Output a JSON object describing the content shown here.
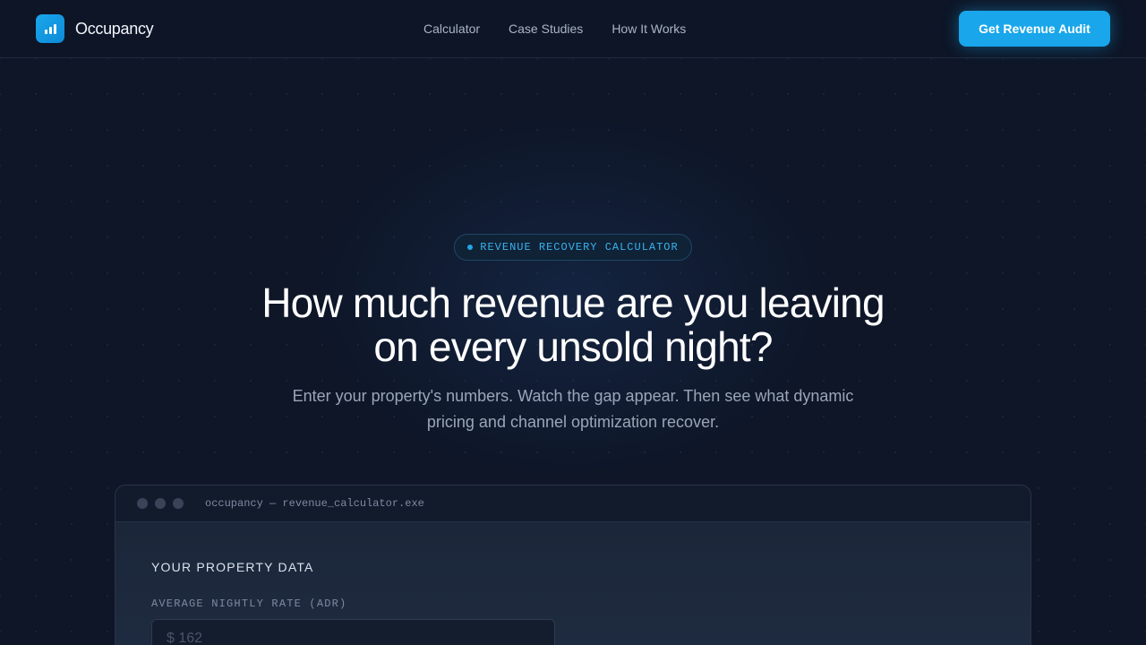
{
  "nav": {
    "logo": "Occupancy",
    "links": [
      "Calculator",
      "Case Studies",
      "How It Works"
    ],
    "cta": "Get Revenue Audit"
  },
  "hero": {
    "badge": "REVENUE RECOVERY CALCULATOR",
    "headline_line1": "How much revenue are you leaving",
    "headline_line2": "on every unsold night?",
    "sub_line1": "Enter your property's numbers. Watch the gap appear. Then see what dynamic",
    "sub_line2": "pricing and channel optimization recover."
  },
  "calculator": {
    "window_title": "occupancy — revenue_calculator.exe",
    "section_title": "YOUR PROPERTY DATA",
    "adr_label": "AVERAGE NIGHTLY RATE (ADR)",
    "currency": "$",
    "adr_value": "162"
  },
  "colors": {
    "accent": "#19a6ea",
    "background": "#0e1627"
  }
}
